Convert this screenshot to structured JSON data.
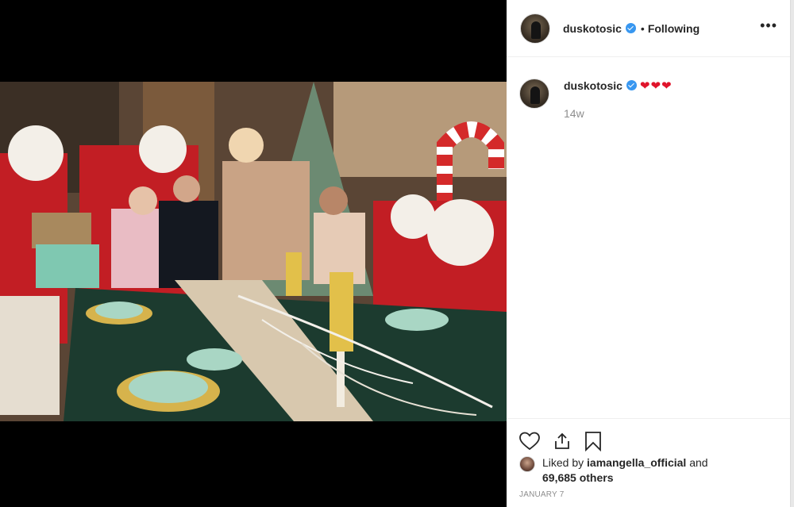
{
  "post": {
    "username": "duskotosic",
    "separator": "•",
    "follow_state": "Following",
    "more_label": "•••",
    "photo_alt": "Christmas table photo with Santas"
  },
  "comment": {
    "username": "duskotosic",
    "hearts": "❤❤❤",
    "time_ago": "14w"
  },
  "likes": {
    "prefix": "Liked by ",
    "liker": "iamangella_official",
    "middle": " and",
    "count": "69,685 others"
  },
  "date": "JANUARY 7",
  "colors": {
    "verified": "#3897f0",
    "heart": "#e0142b",
    "muted": "#8e8e8e"
  },
  "icons": [
    "heart-outline-icon",
    "share-icon",
    "bookmark-icon",
    "verified-badge-icon",
    "more-icon"
  ]
}
